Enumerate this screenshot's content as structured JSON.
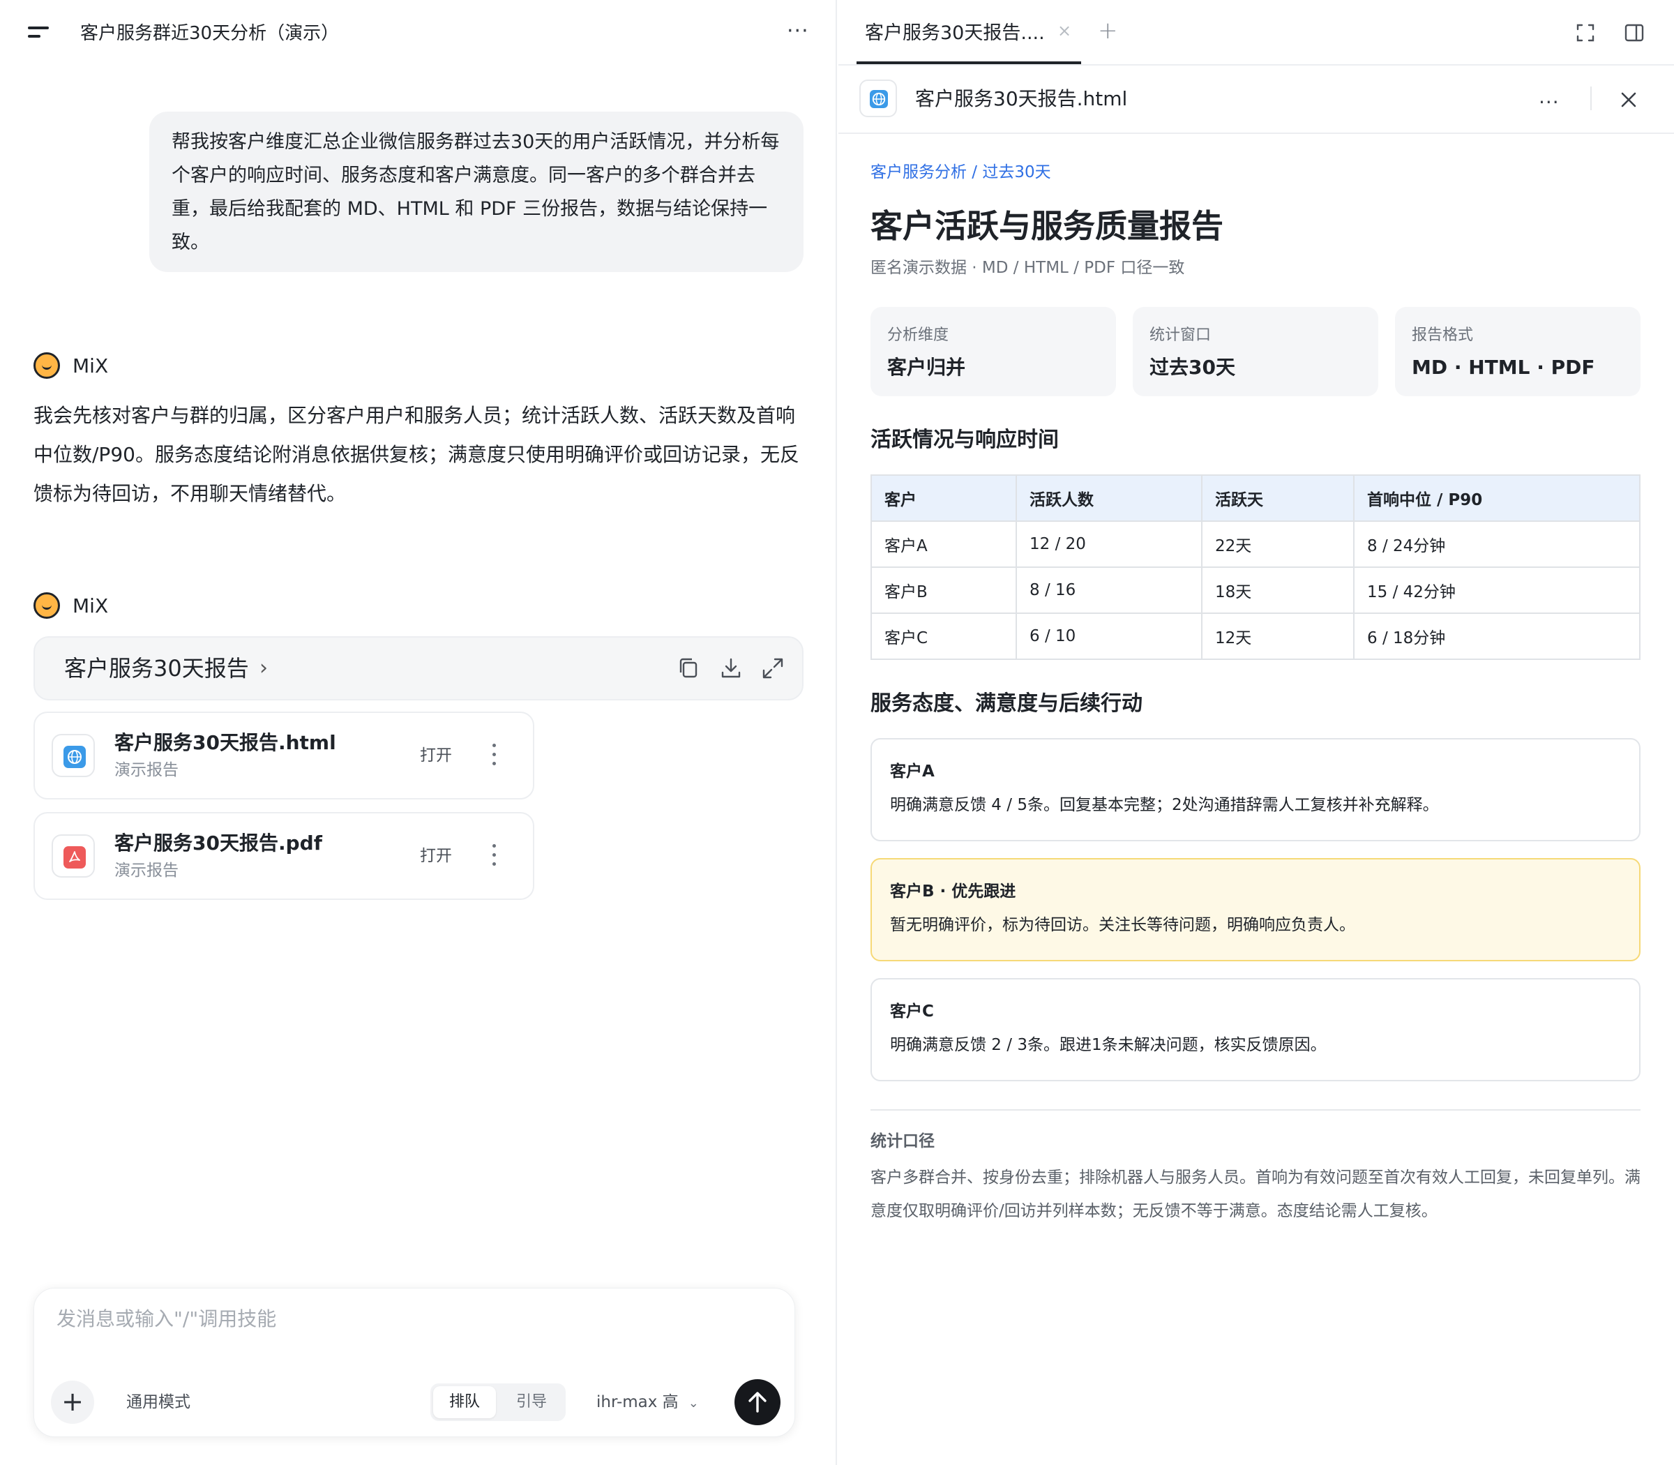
{
  "left": {
    "title": "客户服务群近30天分析（演示）",
    "user_message": "帮我按客户维度汇总企业微信服务群过去30天的用户活跃情况，并分析每个客户的响应时间、服务态度和客户满意度。同一客户的多个群合并去重，最后给我配套的 MD、HTML 和 PDF 三份报告，数据与结论保持一致。",
    "assistant_name": "MiX",
    "assistant_reply": "我会先核对客户与群的归属，区分客户用户和服务人员；统计活跃人数、活跃天数及首响中位数/P90。服务态度结论附消息依据供复核；满意度只使用明确评价或回访记录，无反馈标为待回访，不用聊天情绪替代。",
    "report_card_title": "客户服务30天报告",
    "files": [
      {
        "name": "客户服务30天报告.html",
        "subtitle": "演示报告",
        "action": "打开",
        "icon": "globe-icon",
        "color": "#3b9ae8"
      },
      {
        "name": "客户服务30天报告.pdf",
        "subtitle": "演示报告",
        "action": "打开",
        "icon": "pdf-icon",
        "color": "#ee5a5a"
      }
    ],
    "composer": {
      "placeholder": "发消息或输入\"/\"调用技能",
      "mode": "通用模式",
      "seg_queue": "排队",
      "seg_guide": "引导",
      "model": "ihr-max 高"
    }
  },
  "right": {
    "tab_label": "客户服务30天报告....",
    "file_name": "客户服务30天报告.html",
    "doc": {
      "breadcrumb": "客户服务分析 / 过去30天",
      "title": "客户活跃与服务质量报告",
      "subtitle": "匿名演示数据 · MD / HTML / PDF 口径一致",
      "kpis": [
        {
          "label": "分析维度",
          "value": "客户归并"
        },
        {
          "label": "统计窗口",
          "value": "过去30天"
        },
        {
          "label": "报告格式",
          "value": "MD · HTML · PDF"
        }
      ],
      "section1": "活跃情况与响应时间",
      "table": {
        "headers": [
          "客户",
          "活跃人数",
          "活跃天",
          "首响中位 / P90"
        ],
        "rows": [
          [
            "客户A",
            "12 / 20",
            "22天",
            "8 / 24分钟"
          ],
          [
            "客户B",
            "8 / 16",
            "18天",
            "15 / 42分钟"
          ],
          [
            "客户C",
            "6 / 10",
            "12天",
            "6 / 18分钟"
          ]
        ]
      },
      "section2": "服务态度、满意度与后续行动",
      "notes": [
        {
          "title": "客户A",
          "body": "明确满意反馈 4 / 5条。回复基本完整；2处沟通措辞需人工复核并补充解释。",
          "highlight": false
        },
        {
          "title": "客户B · 优先跟进",
          "body": "暂无明确评价，标为待回访。关注长等待问题，明确响应负责人。",
          "highlight": true
        },
        {
          "title": "客户C",
          "body": "明确满意反馈 2 / 3条。跟进1条未解决问题，核实反馈原因。",
          "highlight": false
        }
      ],
      "method_title": "统计口径",
      "method_body": "客户多群合并、按身份去重；排除机器人与服务人员。首响为有效问题至首次有效人工回复，未回复单列。满意度仅取明确评价/回访并列样本数；无反馈不等于满意。态度结论需人工复核。"
    }
  }
}
